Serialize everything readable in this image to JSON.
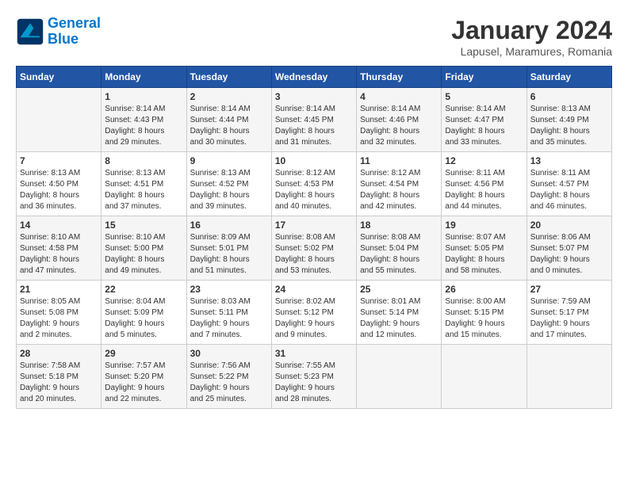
{
  "logo": {
    "line1": "General",
    "line2": "Blue"
  },
  "title": "January 2024",
  "subtitle": "Lapusel, Maramures, Romania",
  "days_of_week": [
    "Sunday",
    "Monday",
    "Tuesday",
    "Wednesday",
    "Thursday",
    "Friday",
    "Saturday"
  ],
  "weeks": [
    [
      {
        "day": "",
        "info": ""
      },
      {
        "day": "1",
        "info": "Sunrise: 8:14 AM\nSunset: 4:43 PM\nDaylight: 8 hours\nand 29 minutes."
      },
      {
        "day": "2",
        "info": "Sunrise: 8:14 AM\nSunset: 4:44 PM\nDaylight: 8 hours\nand 30 minutes."
      },
      {
        "day": "3",
        "info": "Sunrise: 8:14 AM\nSunset: 4:45 PM\nDaylight: 8 hours\nand 31 minutes."
      },
      {
        "day": "4",
        "info": "Sunrise: 8:14 AM\nSunset: 4:46 PM\nDaylight: 8 hours\nand 32 minutes."
      },
      {
        "day": "5",
        "info": "Sunrise: 8:14 AM\nSunset: 4:47 PM\nDaylight: 8 hours\nand 33 minutes."
      },
      {
        "day": "6",
        "info": "Sunrise: 8:13 AM\nSunset: 4:49 PM\nDaylight: 8 hours\nand 35 minutes."
      }
    ],
    [
      {
        "day": "7",
        "info": "Sunrise: 8:13 AM\nSunset: 4:50 PM\nDaylight: 8 hours\nand 36 minutes."
      },
      {
        "day": "8",
        "info": "Sunrise: 8:13 AM\nSunset: 4:51 PM\nDaylight: 8 hours\nand 37 minutes."
      },
      {
        "day": "9",
        "info": "Sunrise: 8:13 AM\nSunset: 4:52 PM\nDaylight: 8 hours\nand 39 minutes."
      },
      {
        "day": "10",
        "info": "Sunrise: 8:12 AM\nSunset: 4:53 PM\nDaylight: 8 hours\nand 40 minutes."
      },
      {
        "day": "11",
        "info": "Sunrise: 8:12 AM\nSunset: 4:54 PM\nDaylight: 8 hours\nand 42 minutes."
      },
      {
        "day": "12",
        "info": "Sunrise: 8:11 AM\nSunset: 4:56 PM\nDaylight: 8 hours\nand 44 minutes."
      },
      {
        "day": "13",
        "info": "Sunrise: 8:11 AM\nSunset: 4:57 PM\nDaylight: 8 hours\nand 46 minutes."
      }
    ],
    [
      {
        "day": "14",
        "info": "Sunrise: 8:10 AM\nSunset: 4:58 PM\nDaylight: 8 hours\nand 47 minutes."
      },
      {
        "day": "15",
        "info": "Sunrise: 8:10 AM\nSunset: 5:00 PM\nDaylight: 8 hours\nand 49 minutes."
      },
      {
        "day": "16",
        "info": "Sunrise: 8:09 AM\nSunset: 5:01 PM\nDaylight: 8 hours\nand 51 minutes."
      },
      {
        "day": "17",
        "info": "Sunrise: 8:08 AM\nSunset: 5:02 PM\nDaylight: 8 hours\nand 53 minutes."
      },
      {
        "day": "18",
        "info": "Sunrise: 8:08 AM\nSunset: 5:04 PM\nDaylight: 8 hours\nand 55 minutes."
      },
      {
        "day": "19",
        "info": "Sunrise: 8:07 AM\nSunset: 5:05 PM\nDaylight: 8 hours\nand 58 minutes."
      },
      {
        "day": "20",
        "info": "Sunrise: 8:06 AM\nSunset: 5:07 PM\nDaylight: 9 hours\nand 0 minutes."
      }
    ],
    [
      {
        "day": "21",
        "info": "Sunrise: 8:05 AM\nSunset: 5:08 PM\nDaylight: 9 hours\nand 2 minutes."
      },
      {
        "day": "22",
        "info": "Sunrise: 8:04 AM\nSunset: 5:09 PM\nDaylight: 9 hours\nand 5 minutes."
      },
      {
        "day": "23",
        "info": "Sunrise: 8:03 AM\nSunset: 5:11 PM\nDaylight: 9 hours\nand 7 minutes."
      },
      {
        "day": "24",
        "info": "Sunrise: 8:02 AM\nSunset: 5:12 PM\nDaylight: 9 hours\nand 9 minutes."
      },
      {
        "day": "25",
        "info": "Sunrise: 8:01 AM\nSunset: 5:14 PM\nDaylight: 9 hours\nand 12 minutes."
      },
      {
        "day": "26",
        "info": "Sunrise: 8:00 AM\nSunset: 5:15 PM\nDaylight: 9 hours\nand 15 minutes."
      },
      {
        "day": "27",
        "info": "Sunrise: 7:59 AM\nSunset: 5:17 PM\nDaylight: 9 hours\nand 17 minutes."
      }
    ],
    [
      {
        "day": "28",
        "info": "Sunrise: 7:58 AM\nSunset: 5:18 PM\nDaylight: 9 hours\nand 20 minutes."
      },
      {
        "day": "29",
        "info": "Sunrise: 7:57 AM\nSunset: 5:20 PM\nDaylight: 9 hours\nand 22 minutes."
      },
      {
        "day": "30",
        "info": "Sunrise: 7:56 AM\nSunset: 5:22 PM\nDaylight: 9 hours\nand 25 minutes."
      },
      {
        "day": "31",
        "info": "Sunrise: 7:55 AM\nSunset: 5:23 PM\nDaylight: 9 hours\nand 28 minutes."
      },
      {
        "day": "",
        "info": ""
      },
      {
        "day": "",
        "info": ""
      },
      {
        "day": "",
        "info": ""
      }
    ]
  ]
}
